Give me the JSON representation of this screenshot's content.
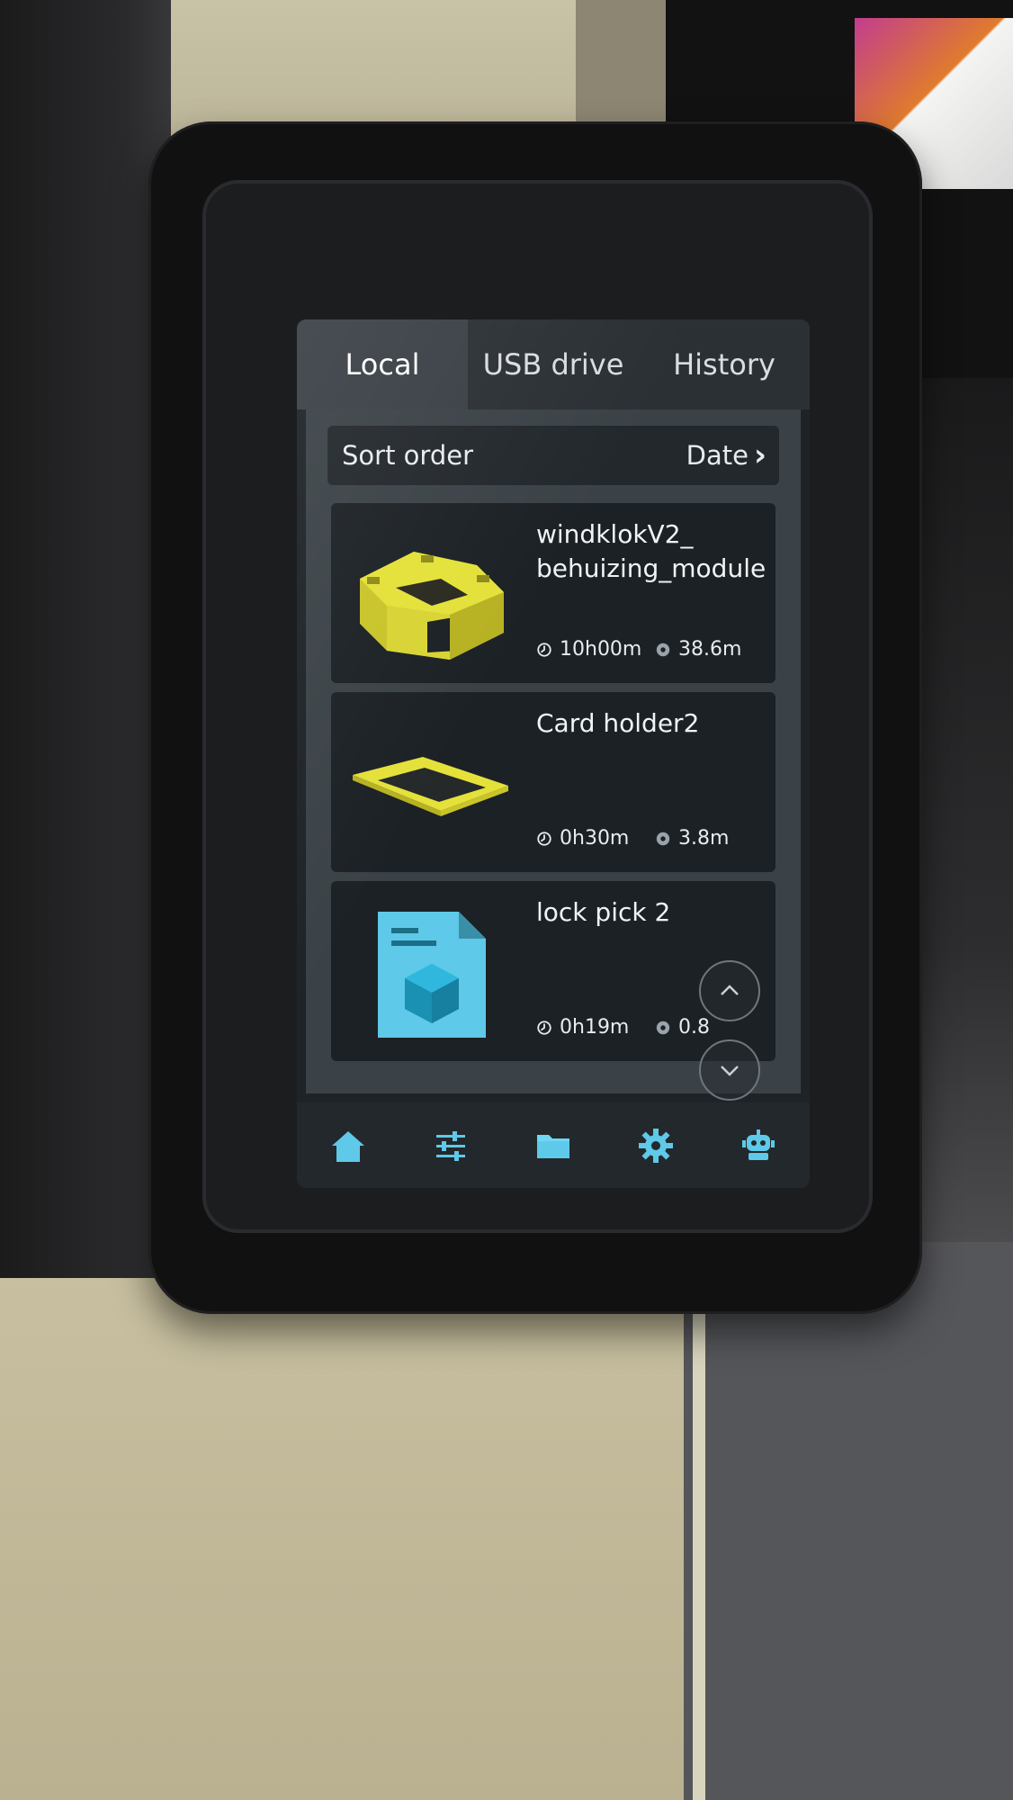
{
  "tabs": [
    {
      "label": "Local",
      "active": true
    },
    {
      "label": "USB drive",
      "active": false
    },
    {
      "label": "History",
      "active": false
    }
  ],
  "sort": {
    "label": "Sort order",
    "value": "Date"
  },
  "files": [
    {
      "name": "windklokV2_\nbehuizing_module",
      "time": "10h00m",
      "filament": "38.6m",
      "thumbnail": "yellow-model"
    },
    {
      "name": "Card holder2",
      "time": "0h30m",
      "filament": "3.8m",
      "thumbnail": "yellow-plate"
    },
    {
      "name": "lock pick 2",
      "time": "0h19m",
      "filament": "0.8",
      "thumbnail": "generic-file-icon"
    }
  ],
  "nav": [
    {
      "icon": "home-icon",
      "active": false
    },
    {
      "icon": "sliders-icon",
      "active": false
    },
    {
      "icon": "folder-icon",
      "active": true
    },
    {
      "icon": "gear-icon",
      "active": false
    },
    {
      "icon": "robot-icon",
      "active": false
    }
  ],
  "colors": {
    "accent": "#5ec9e8",
    "model": "#e4e13a"
  }
}
